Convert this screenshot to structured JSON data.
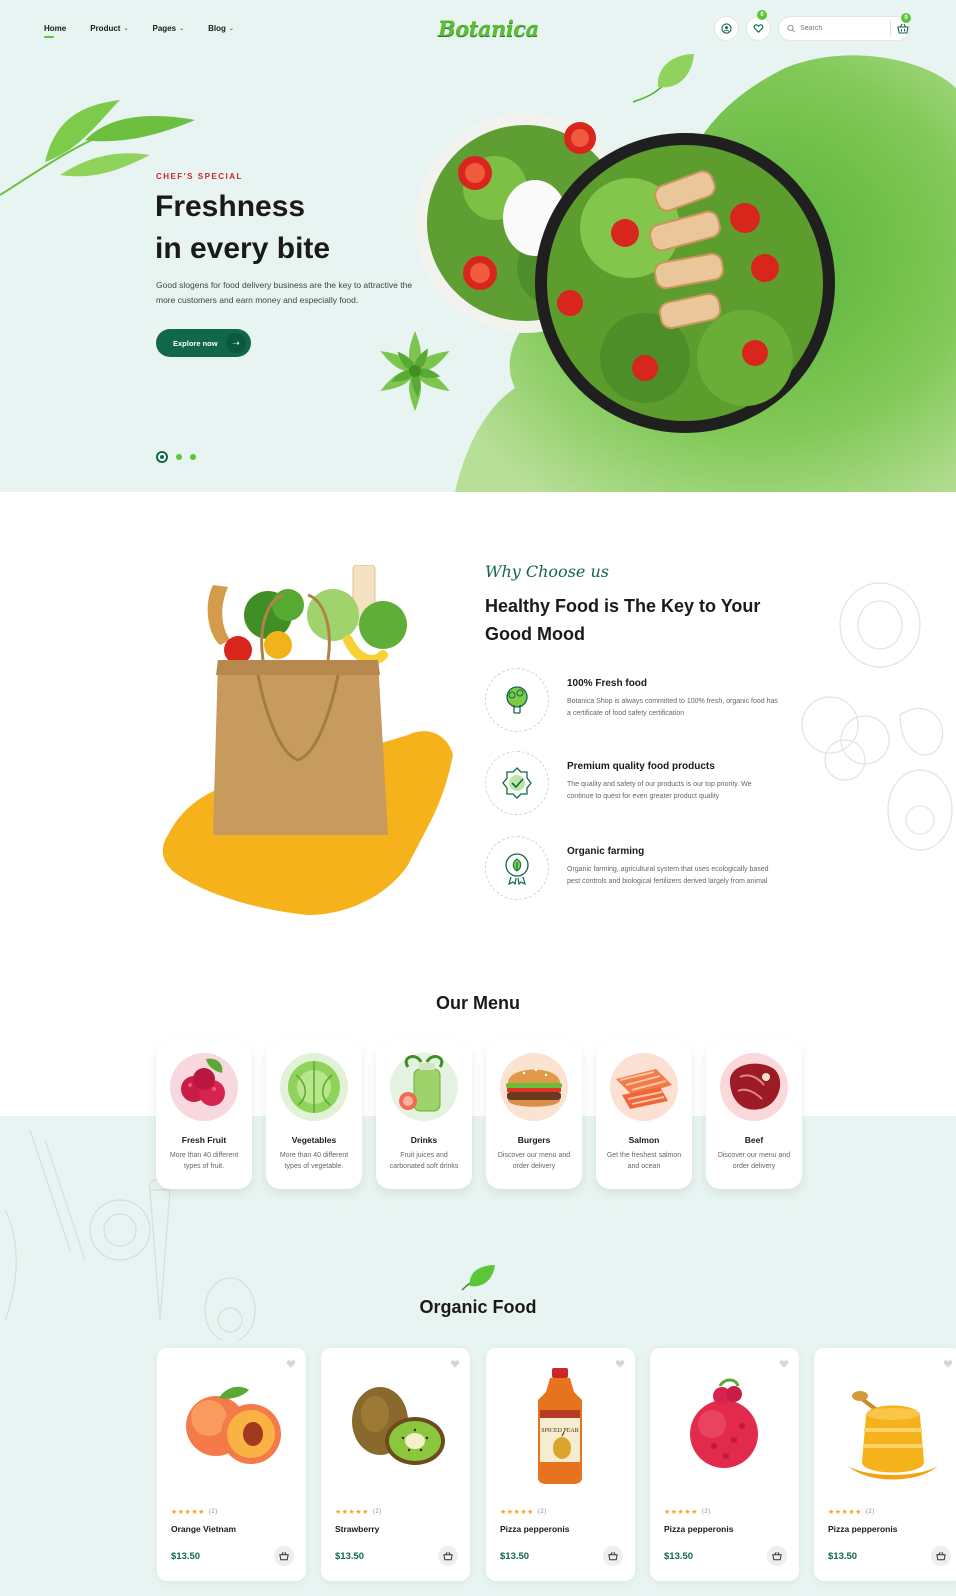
{
  "header": {
    "nav": [
      {
        "label": "Home",
        "active": true,
        "dropdown": false
      },
      {
        "label": "Product",
        "active": false,
        "dropdown": true
      },
      {
        "label": "Pages",
        "active": false,
        "dropdown": true
      },
      {
        "label": "Blog",
        "active": false,
        "dropdown": true
      }
    ],
    "logo": "Botanica",
    "wishlist_count": "0",
    "cart_count": "0",
    "search_placeholder": "Search",
    "icons": [
      "user-icon",
      "heart-icon",
      "search-icon",
      "basket-icon"
    ]
  },
  "hero": {
    "subtitle": "CHEF'S SPECIAL",
    "title_line1": "Freshness",
    "title_line2": "in every bite",
    "description": "Good slogens for food delivery business are the key to attractive the more customers and earn money and especially food.",
    "cta": "Explore now",
    "slides": 3,
    "active_slide": 1
  },
  "why": {
    "script": "Why Choose us",
    "title": "Healthy Food is The Key to Your Good Mood",
    "features": [
      {
        "title": "100% Fresh food",
        "desc": "Botanica Shop is always committed to 100% fresh, organic food has a certificate of food safety certification",
        "icon": "broccoli-icon"
      },
      {
        "title": "Premium quality food products",
        "desc": "The quality and safety of our products is our top priority. We continue to quest for even greater product quality",
        "icon": "quality-badge-icon"
      },
      {
        "title": "Organic farming",
        "desc": "Organic farming, agricultural system that uses ecologically based pest controls and biological fertilizers derived largely from animal",
        "icon": "organic-leaf-badge-icon"
      }
    ]
  },
  "menu": {
    "title": "Our Menu",
    "items": [
      {
        "name": "Fresh Fruit",
        "desc": "More than 40 different types of fruit."
      },
      {
        "name": "Vegetables",
        "desc": "More than 40 different types of vegetable."
      },
      {
        "name": "Drinks",
        "desc": "Fruit juices and carbonated soft drinks"
      },
      {
        "name": "Burgers",
        "desc": "Discover our menu and order delivery"
      },
      {
        "name": "Salmon",
        "desc": "Get the freshest salmon and ocean"
      },
      {
        "name": "Beef",
        "desc": "Discover our menu and order delivery"
      }
    ]
  },
  "organic": {
    "title": "Organic Food",
    "products": [
      {
        "name": "Orange Vietnam",
        "price": "$13.50",
        "rating": 5,
        "reviews": "(2)"
      },
      {
        "name": "Strawberry",
        "price": "$13.50",
        "rating": 5,
        "reviews": "(2)"
      },
      {
        "name": "Pizza pepperonis",
        "price": "$13.50",
        "rating": 5,
        "reviews": "(2)",
        "label_text": "SPICED PEAR"
      },
      {
        "name": "Pizza pepperonis",
        "price": "$13.50",
        "rating": 5,
        "reviews": "(2)"
      },
      {
        "name": "Pizza pepperonis",
        "price": "$13.50",
        "rating": 5,
        "reviews": "(2)"
      }
    ]
  },
  "colors": {
    "primary": "#10674a",
    "accent": "#5cc63b",
    "hero_bg": "#e7f4f1",
    "sale_red": "#c8282a",
    "star": "#f5a623",
    "bag_splash": "#f6b21a"
  }
}
